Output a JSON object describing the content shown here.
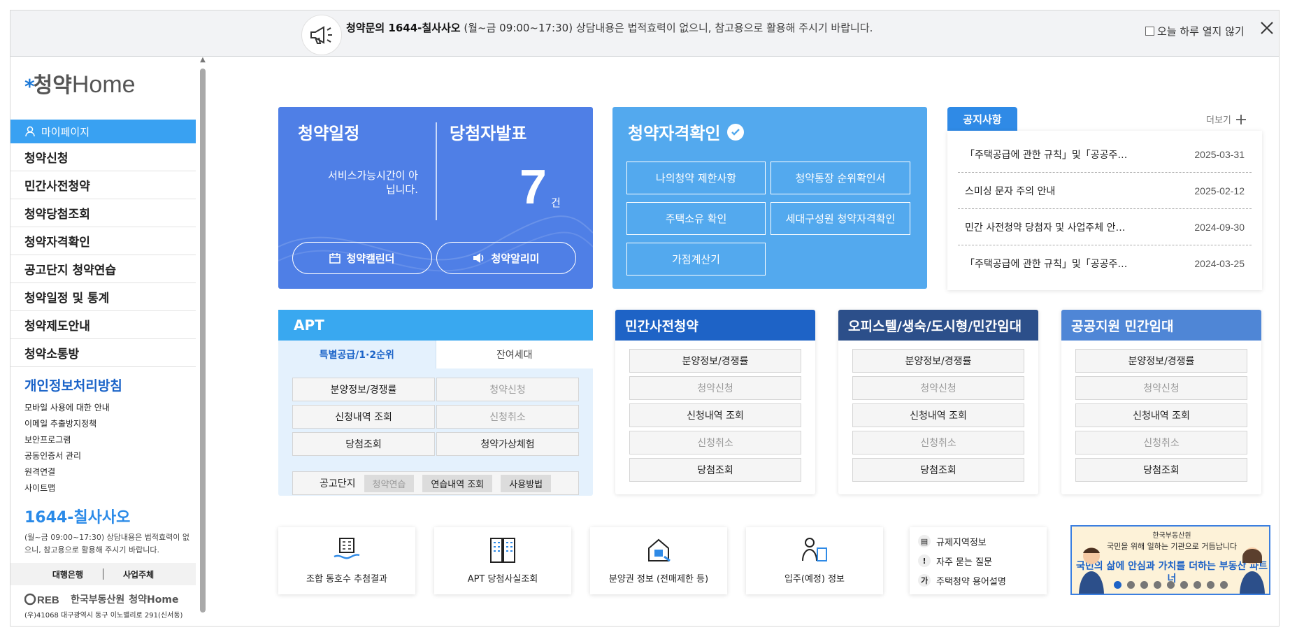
{
  "notice": {
    "title": "청약문의 1644-칠사사오",
    "hours": "(월~금 09:00~17:30)",
    "message": "상담내용은 법적효력이 없으니, 참고용으로 활용해 주시기 바랍니다.",
    "dont_show": "오늘 하루 열지 않기"
  },
  "sidebar": {
    "logo_text": "청약",
    "logo_home": "Home",
    "mypage": "마이페이지",
    "items": [
      "청약신청",
      "민간사전청약",
      "청약당첨조회",
      "청약자격확인",
      "공고단지 청약연습",
      "청약일정 및 통계",
      "청약제도안내",
      "청약소통방"
    ],
    "policy_title": "개인정보처리방침",
    "policy_links": [
      "모바일 사용에 대한 안내",
      "이메일 추출방지정책",
      "보안프로그램",
      "공동인증서 관리",
      "원격연결",
      "사이트맵"
    ],
    "cc_number": "1644-칠사사오",
    "cc_desc": "(월~금 09:00~17:30) 상담내용은 법적효력이 없으니, 참고용으로 활용해 주시기 바랍니다.",
    "bank": "대행은행",
    "operator": "사업주체",
    "footer_brand": "한국부동산원",
    "footer_brand2": "청약Home",
    "footer_addr": "(우)41068 대구광역시 동구 이노밸리로 291(신서동)"
  },
  "schedule": {
    "title": "청약일정",
    "winners_title": "당첨자발표",
    "service_msg": "서비스가능시간이 아닙니다.",
    "count": "7",
    "count_unit": "건",
    "calendar_btn": "청약캘린더",
    "alarm_btn": "청약알리미"
  },
  "eligibility": {
    "title": "청약자격확인",
    "buttons": [
      "나의청약 제한사항",
      "청약통장 순위확인서",
      "주택소유 확인",
      "세대구성원 청약자격확인",
      "가점계산기"
    ]
  },
  "notices": {
    "tab": "공지사항",
    "more": "더보기",
    "items": [
      {
        "title": "「주택공급에 관한 규칙」및「공공주…",
        "date": "2025-03-31"
      },
      {
        "title": "스미싱 문자 주의 안내",
        "date": "2025-02-12"
      },
      {
        "title": "민간 사전청약 당첨자 및 사업주체 안…",
        "date": "2024-09-30"
      },
      {
        "title": "「주택공급에 관한 규칙」및「공공주…",
        "date": "2024-03-25"
      }
    ]
  },
  "apt": {
    "title": "APT",
    "tab_on": "특별공급/1·2순위",
    "tab_off": "잔여세대",
    "buttons": [
      "분양정보/경쟁률",
      "청약신청",
      "신청내역 조회",
      "신청취소",
      "당첨조회",
      "청약가상체험"
    ],
    "gonggo_label": "공고단지",
    "gonggo_pills": [
      "청약연습",
      "연습내역 조회",
      "사용방법"
    ]
  },
  "categories": [
    {
      "title": "민간사전청약",
      "buttons": [
        "분양정보/경쟁률",
        "청약신청",
        "신청내역 조회",
        "신청취소",
        "당첨조회"
      ]
    },
    {
      "title": "오피스텔/생숙/도시형/민간임대",
      "buttons": [
        "분양정보/경쟁률",
        "청약신청",
        "신청내역 조회",
        "신청취소",
        "당첨조회"
      ]
    },
    {
      "title": "공공지원 민간임대",
      "buttons": [
        "분양정보/경쟁률",
        "청약신청",
        "신청내역 조회",
        "신청취소",
        "당첨조회"
      ]
    }
  ],
  "quick": [
    "조합 동호수 추첨결과",
    "APT 당첨사실조회",
    "분양권 정보 (전매제한 등)",
    "입주(예정) 정보"
  ],
  "links": [
    "규제지역정보",
    "자주 묻는 질문",
    "주택청약 용어설명"
  ],
  "promo": {
    "org": "한국부동산원",
    "line1": "국민을 위해 일하는 기관으로 거듭납니다",
    "line2": "국민의 삶에 안심과 가치를 더하는 부동산 파트너"
  }
}
